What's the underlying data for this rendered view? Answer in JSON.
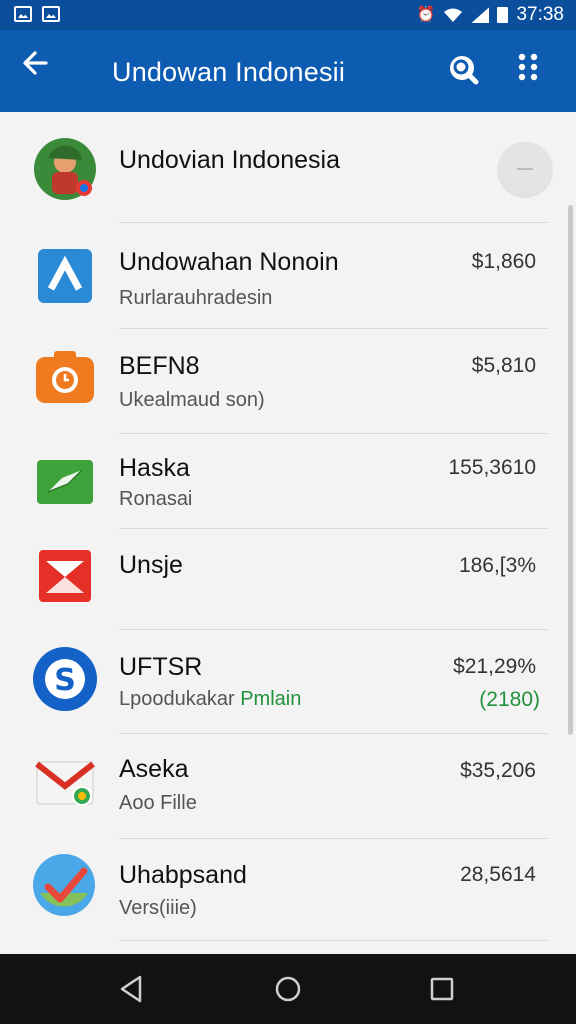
{
  "status_bar": {
    "time": "37:38",
    "icons": [
      "gallery-icon",
      "image-icon",
      "alarm-icon",
      "wifi-icon",
      "signal-icon",
      "battery-icon"
    ]
  },
  "app_bar": {
    "title": "Undowan Indonesii",
    "back_icon": "arrow-back-icon",
    "search_icon": "search-icon",
    "more_icon": "more-options-icon"
  },
  "header": {
    "title": "Undovian Indonesia",
    "toggle_icon": "collapse-icon"
  },
  "items": [
    {
      "title": "Undowahan Nonoin",
      "subtitle": "Rurlarauhradesin",
      "value": "$1,860",
      "icon": "blue-a-app-icon",
      "color": "#2a8ad6"
    },
    {
      "title": "BEFN8",
      "subtitle": "Ukealmaud son)",
      "value": "$5,810",
      "icon": "orange-camera-app-icon",
      "color": "#f07a1f"
    },
    {
      "title": "Haska",
      "subtitle": "Ronasai",
      "value": "155,3610",
      "icon": "green-chat-app-icon",
      "color": "#3ea33a"
    },
    {
      "title": "Unsje",
      "subtitle": "",
      "value": "186,[3%",
      "icon": "red-envelope-app-icon",
      "color": "#e53027"
    },
    {
      "title": "UFTSR",
      "subtitle": "Lpoodukakar",
      "subtitle_accent": "Pmlain",
      "value": "$21,29%",
      "value2": "(2180)",
      "icon": "blue-s-app-icon",
      "color": "#1462c7"
    },
    {
      "title": "Aseka",
      "subtitle": "Aoo Fille",
      "value": "$35,206",
      "icon": "mail-app-icon",
      "color": "#d93025"
    },
    {
      "title": "Uhabpsand",
      "subtitle": "Vers(iiie)",
      "value": "28,5614",
      "icon": "check-app-icon",
      "color": "#4aa8e8"
    }
  ],
  "nav_bar": {
    "back": "nav-back-icon",
    "home": "nav-home-icon",
    "recents": "nav-recents-icon"
  },
  "colors": {
    "app_bar": "#0d5cb2",
    "status_bar": "#0b4f9c",
    "accent_green": "#23913b",
    "nav_bar": "#121212"
  }
}
